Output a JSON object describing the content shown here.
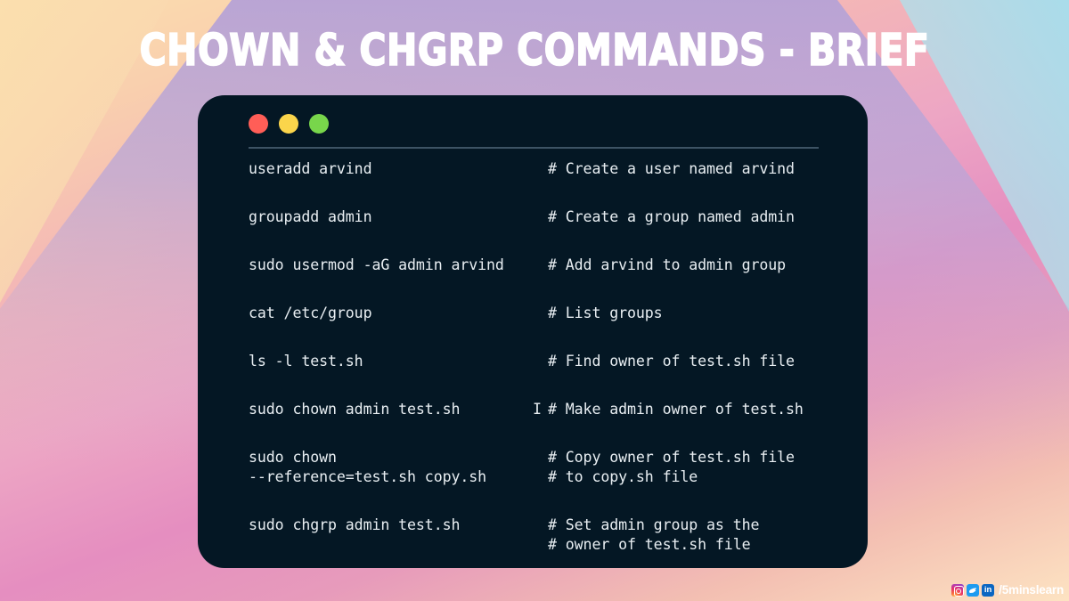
{
  "slide": {
    "title": "CHOWN & CHGRP COMMANDS - BRIEF",
    "title_color": "#ffffff",
    "background_colors": {
      "top_left": "#fbe0ae",
      "top_center": "#b7a4d4",
      "top_right": "#abdded",
      "bottom_left": "#e58ec0",
      "bottom_right": "#fbdcbd"
    }
  },
  "terminal": {
    "background_color": "#041724",
    "text_color": "#e8eef2",
    "divider_color": "#3d5364",
    "buttons": [
      {
        "name": "close",
        "color": "#ff5e57"
      },
      {
        "name": "minimize",
        "color": "#fbd54b"
      },
      {
        "name": "maximize",
        "color": "#78d64b"
      }
    ],
    "lines": [
      {
        "command": "useradd arvind",
        "cursor": "",
        "comment": "# Create a user named arvind",
        "spaced": false
      },
      {
        "command": "groupadd admin",
        "cursor": "",
        "comment": "# Create a group named admin",
        "spaced": true
      },
      {
        "command": "sudo usermod -aG admin arvind",
        "cursor": "",
        "comment": "# Add arvind to admin group",
        "spaced": true
      },
      {
        "command": "cat /etc/group",
        "cursor": "",
        "comment": "# List groups",
        "spaced": true
      },
      {
        "command": "ls -l test.sh",
        "cursor": "",
        "comment": "# Find owner of test.sh file",
        "spaced": true
      },
      {
        "command": "sudo chown admin test.sh",
        "cursor": "I",
        "comment": "# Make admin owner of test.sh",
        "spaced": true
      },
      {
        "command": "sudo chown",
        "cursor": "",
        "comment": "# Copy owner of test.sh file",
        "spaced": true
      },
      {
        "command": "--reference=test.sh copy.sh",
        "cursor": "",
        "comment": "# to copy.sh file",
        "spaced": false
      },
      {
        "command": "sudo chgrp admin test.sh",
        "cursor": "",
        "comment": "# Set admin group as the",
        "spaced": true
      },
      {
        "command": "",
        "cursor": "",
        "comment": "# owner of test.sh file",
        "spaced": false
      }
    ]
  },
  "watermark": {
    "handle": "/5minslearn",
    "icons": [
      {
        "name": "instagram-icon",
        "label": ""
      },
      {
        "name": "twitter-icon",
        "label": ""
      },
      {
        "name": "linkedin-icon",
        "label": "in"
      }
    ]
  }
}
